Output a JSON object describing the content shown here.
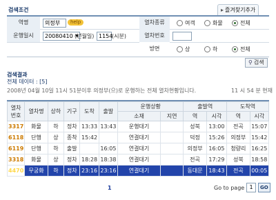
{
  "search": {
    "title": "검색조건",
    "favorites_label": "즐겨찾기추가",
    "station_label": "역명",
    "station_value": "의정부",
    "help_label": "help",
    "date_label": "운행일시",
    "date_value": "20080410",
    "date_suffix": "(년월일)",
    "time_value": "1154",
    "time_suffix": "(시분)",
    "type_label": "열차종류",
    "type_options": [
      "여객",
      "화물",
      "전체"
    ],
    "number_label": "열차번호",
    "number_value": "",
    "direction_label": "방면",
    "direction_options": [
      "상",
      "하",
      "전체"
    ],
    "search_button": "검색"
  },
  "result": {
    "title": "검색결과",
    "total": "전체 데이터 : [5]",
    "description": "2008년 04월 10일 11시 51분이후 의정부(으)로 운행하는 전체 열차현황입니다.",
    "status_time": "11 시 54 분 현재",
    "headers": {
      "train": "열차",
      "number": "번호",
      "name": "열차명",
      "updown": "상하",
      "origin": "기구",
      "arrival": "도착",
      "departure": "출발",
      "status_group": "운행상황",
      "location": "소재",
      "delay": "지연",
      "from_group": "출발역",
      "station": "역",
      "time": "시각",
      "to_group": "도착역"
    },
    "rows": [
      {
        "no": "3317",
        "name": "화물",
        "dir": "하",
        "org": "정차",
        "arr": "13:33",
        "dep": "13:43",
        "loc": "운행대기",
        "delay": "",
        "from": "성북",
        "from_t": "13:00",
        "to": "전곡",
        "to_t": "15:07"
      },
      {
        "no": "6118",
        "name": "단행",
        "dir": "상",
        "org": "종착",
        "arr": "15:42",
        "dep": "",
        "loc": "연결대기",
        "delay": "",
        "from": "덕정",
        "from_t": "15:26",
        "to": "의정부",
        "to_t": "15:42"
      },
      {
        "no": "6119",
        "name": "단행",
        "dir": "하",
        "org": "출발",
        "arr": "",
        "dep": "16:05",
        "loc": "연결대기",
        "delay": "",
        "from": "의정부",
        "from_t": "16:05",
        "to": "청량리",
        "to_t": "16:25"
      },
      {
        "no": "3318",
        "name": "화물",
        "dir": "상",
        "org": "정차",
        "arr": "18:28",
        "dep": "18:38",
        "loc": "연결대기",
        "delay": "",
        "from": "전곡",
        "from_t": "17:29",
        "to": "성북",
        "to_t": "18:58"
      },
      {
        "no": "4470",
        "name": "무궁화",
        "dir": "하",
        "org": "정차",
        "arr": "23:16",
        "dep": "23:16",
        "loc": "연결대기",
        "delay": "",
        "from": "동대문",
        "from_t": "18:43",
        "to": "전곡",
        "to_t": "00:05",
        "selected": true
      }
    ]
  },
  "pager": {
    "current": "1",
    "goto_label": "Go to page :",
    "goto_value": "1",
    "go_button": "GO"
  }
}
